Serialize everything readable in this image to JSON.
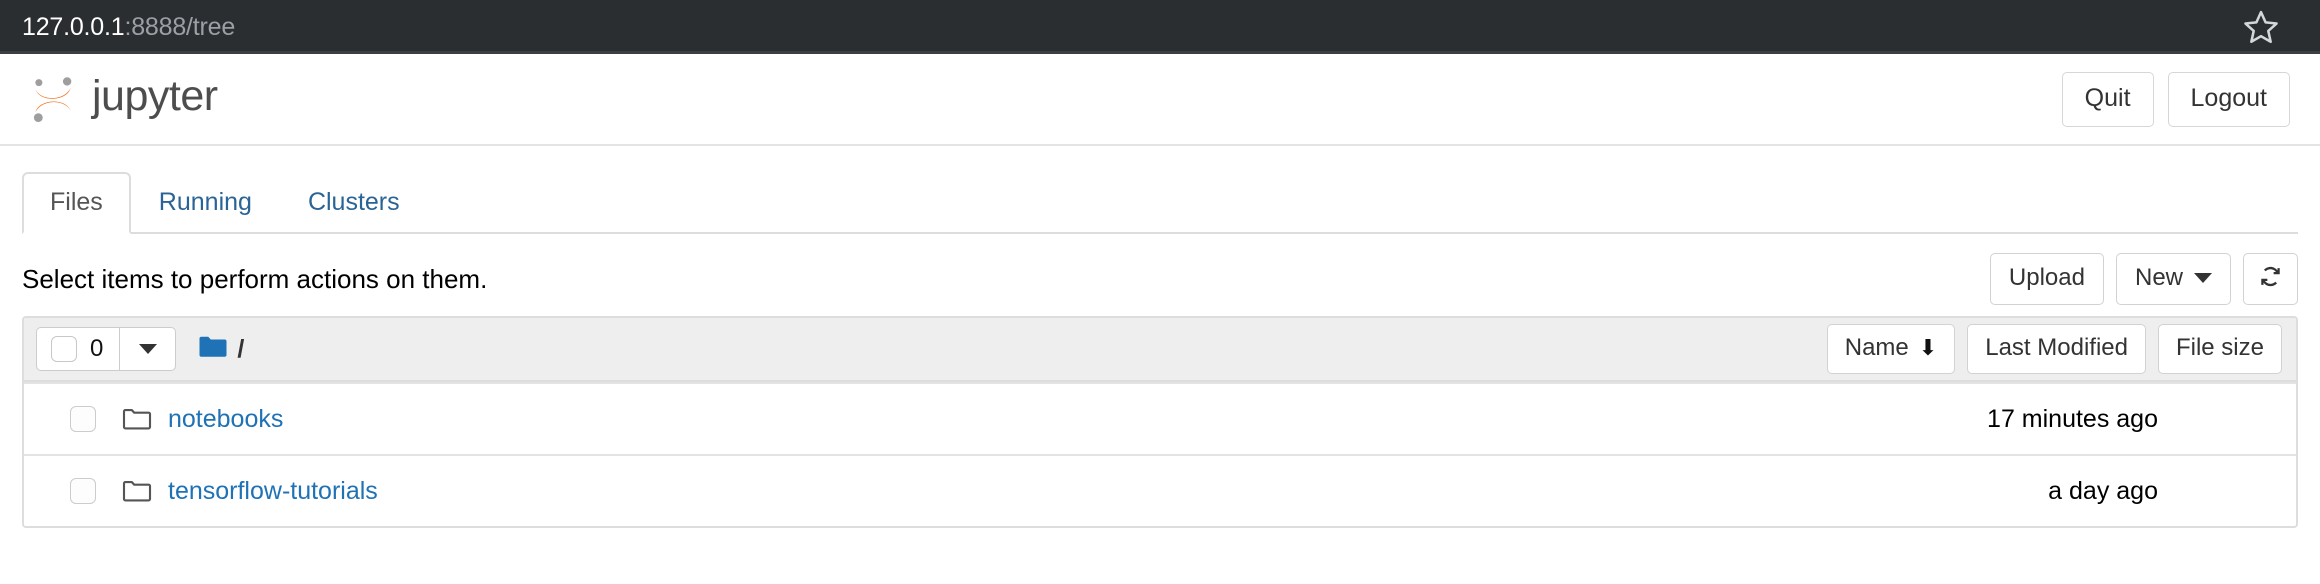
{
  "browser": {
    "url_host": "127.0.0.1",
    "url_rest": ":8888/tree",
    "bookmark_icon": "star-outline-icon"
  },
  "header": {
    "brand": "jupyter",
    "logo_icon": "jupyter-logo-icon",
    "quit_label": "Quit",
    "logout_label": "Logout"
  },
  "tabs": [
    {
      "label": "Files",
      "active": true
    },
    {
      "label": "Running",
      "active": false
    },
    {
      "label": "Clusters",
      "active": false
    }
  ],
  "toolbar": {
    "hint": "Select items to perform actions on them.",
    "upload_label": "Upload",
    "new_label": "New",
    "new_caret_icon": "chevron-down-icon",
    "refresh_icon": "refresh-icon"
  },
  "filelist": {
    "select_count": "0",
    "select_checkbox_icon": "checkbox-icon",
    "select_caret_icon": "chevron-down-icon",
    "breadcrumb_folder_icon": "folder-filled-icon",
    "breadcrumb_path": "/",
    "sort": {
      "name_label": "Name",
      "name_sort_icon": "arrow-down-icon",
      "modified_label": "Last Modified",
      "size_label": "File size"
    },
    "rows": [
      {
        "checkbox_icon": "checkbox-icon",
        "icon": "folder-outline-icon",
        "name": "notebooks",
        "modified": "17 minutes ago",
        "size": ""
      },
      {
        "checkbox_icon": "checkbox-icon",
        "icon": "folder-outline-icon",
        "name": "tensorflow-tutorials",
        "modified": "a day ago",
        "size": ""
      }
    ]
  },
  "colors": {
    "urlbar_bg": "#2b2e31",
    "link": "#1f72b5",
    "tab_link": "#2a6496",
    "brand_orange": "#f37726",
    "brand_gray": "#9e9e9e",
    "list_header_bg": "#eeeeee",
    "folder_blue": "#1f72b5"
  }
}
